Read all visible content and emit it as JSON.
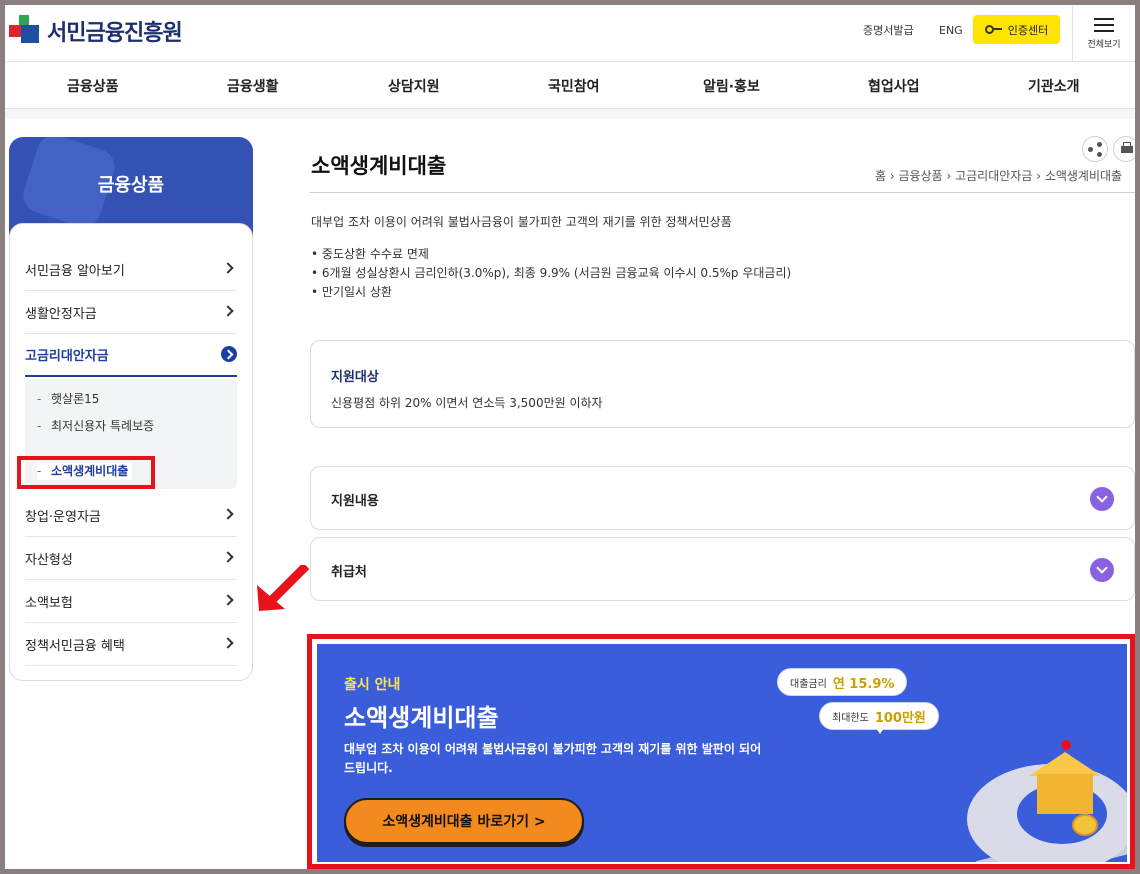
{
  "header": {
    "logo_text": "서민금융진흥원",
    "util_certificate": "증명서발급",
    "util_eng": "ENG",
    "util_cert_center": "인증센터",
    "menu_all": "전체보기"
  },
  "gnb": [
    "금융상품",
    "금융생활",
    "상담지원",
    "국민참여",
    "알림·홍보",
    "협업사업",
    "기관소개"
  ],
  "sidebar": {
    "title": "금융상품",
    "items": [
      {
        "label": "서민금융 알아보기"
      },
      {
        "label": "생활안정자금"
      },
      {
        "label": "고금리대안자금"
      },
      {
        "label": "창업·운영자금"
      },
      {
        "label": "자산형성"
      },
      {
        "label": "소액보험"
      },
      {
        "label": "정책서민금융 혜택"
      }
    ],
    "sub_items": [
      {
        "label": "햇살론15"
      },
      {
        "label": "최저신용자 특례보증"
      },
      {
        "label": "소액생계비대출"
      }
    ]
  },
  "main": {
    "title": "소액생계비대출",
    "breadcrumb": [
      "홈",
      "금융상품",
      "고금리대안자금",
      "소액생계비대출"
    ],
    "description": "대부업 조차 이용이 어려워 불법사금융이 불가피한 고객의 재기를 위한 정책서민상품",
    "bullets": [
      "중도상환 수수료 면제",
      "6개월 성실상환시 금리인하(3.0%p), 최종 9.9% (서금원 금융교육 이수시 0.5%p 우대금리)",
      "만기일시 상환"
    ],
    "support_target": {
      "title": "지원대상",
      "body": "신용평점 하위 20% 이면서 연소득 3,500만원 이하자"
    },
    "accordions": [
      {
        "title": "지원내용"
      },
      {
        "title": "취급처"
      }
    ]
  },
  "banner": {
    "tag": "출시 안내",
    "title": "소액생계비대출",
    "desc": "대부업 조차 이용이 어려워 불법사금융이 불가피한 고객의 재기를 위한 발판이 되어드립니다.",
    "button": "소액생계비대출 바로가기 >",
    "rate_label": "대출금리",
    "rate_value": "연 15.9%",
    "limit_label": "최대한도",
    "limit_value": "100만원"
  },
  "colors": {
    "brand_blue": "#3352b3",
    "accent_yellow": "#ffe400",
    "banner_blue": "#3a5ddb",
    "highlight_red": "#e8131a",
    "accordion_purple": "#8a62e0"
  }
}
